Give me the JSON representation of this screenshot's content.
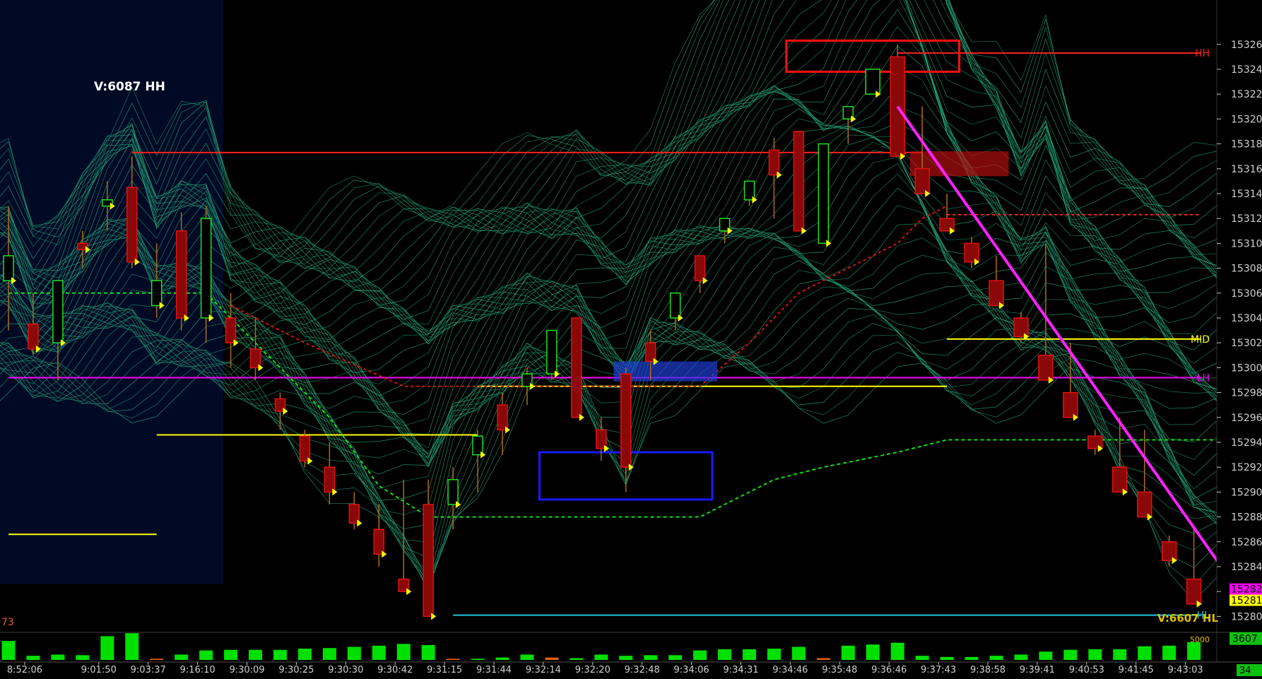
{
  "chart_data": {
    "type": "candlestick",
    "price_axis": {
      "ylim": [
        15279,
        15329
      ],
      "ticks": [
        15280,
        15282,
        15284,
        15286,
        15288,
        15290,
        15292,
        15294,
        15296,
        15298,
        15300,
        15302,
        15304,
        15306,
        15308,
        15310,
        15312,
        15314,
        15316,
        15318,
        15320,
        15322,
        15324,
        15326
      ],
      "tick_labels": [
        "15280",
        "15282",
        "15284",
        "15286",
        "15288",
        "15290",
        "15292",
        "15294",
        "15296",
        "15298",
        "15300",
        "15302",
        "15304",
        "15306",
        "15308",
        "15310",
        "15312",
        "15314",
        "15316",
        "15318",
        "15320",
        "15322",
        "15324",
        "15326"
      ],
      "markers": [
        {
          "label": "15282",
          "value": 15282.2,
          "color": "#ff00ff"
        },
        {
          "label": "15281",
          "value": 15281.3,
          "color": "#ffff00"
        }
      ]
    },
    "time_axis": {
      "labels": [
        "8:52:06",
        "9:01:50",
        "9:03:37",
        "9:16:10",
        "9:30:09",
        "9:30:25",
        "9:30:30",
        "9:30:42",
        "9:31:15",
        "9:31:44",
        "9:32:14",
        "9:32:20",
        "9:32:48",
        "9:34:06",
        "9:34:31",
        "9:34:46",
        "9:35:48",
        "9:36:46",
        "9:37:43",
        "9:38:58",
        "9:39:41",
        "9:40:53",
        "9:41:45",
        "9:43:03"
      ],
      "bar_index": [
        1,
        4,
        6,
        8,
        10,
        12,
        14,
        16,
        18,
        20,
        22,
        24,
        26,
        28,
        30,
        32,
        34,
        36,
        38,
        40,
        42,
        44,
        46,
        48
      ],
      "last_label": "34"
    },
    "annotation": "V:6087 HH",
    "bottom_text": "V:6607 HL",
    "volume_info": {
      "scale_max_label": "5000",
      "current_label": "3607",
      "current_value": 3607,
      "left_value": "73"
    },
    "level_labels": [
      {
        "label": "HH",
        "value": 15325.3,
        "color": "#ff2020"
      },
      {
        "label": "MID",
        "value": 15302.3,
        "color": "#ffff00"
      },
      {
        "label": "LH",
        "value": 15299.2,
        "color": "#ff00ff"
      },
      {
        "label": "HL",
        "value": 15280.1,
        "color": "#20c8e0"
      }
    ],
    "levels": [
      {
        "name": "HH",
        "value": 15325.3,
        "x_from": 36,
        "x_to": 50,
        "color": "#ff2020"
      },
      {
        "name": "upper-red",
        "value": 15317.3,
        "x_from": 5,
        "x_to": 37,
        "color": "#ff2020"
      },
      {
        "name": "red-dashed",
        "value": 15312.3,
        "x_from": 38,
        "x_to": 50,
        "color": "#ff2020",
        "dashed": true
      },
      {
        "name": "MID",
        "value": 15302.3,
        "x_from": 38,
        "x_to": 50,
        "color": "#ffff00"
      },
      {
        "name": "LH",
        "value": 15299.2,
        "x_from": 0,
        "x_to": 50,
        "color": "#ff00ff"
      },
      {
        "name": "yellow-mid",
        "value": 15298.5,
        "x_from": 19,
        "x_to": 38,
        "color": "#ffff00"
      },
      {
        "name": "yellow-low",
        "value": 15294.6,
        "x_from": 6,
        "x_to": 19,
        "color": "#ffff00"
      },
      {
        "name": "yellow-left",
        "value": 15286.6,
        "x_from": 0,
        "x_to": 6,
        "color": "#ffff00"
      },
      {
        "name": "HL",
        "value": 15280.1,
        "x_from": 18,
        "x_to": 50,
        "color": "#20c8e0"
      }
    ],
    "green_dashed_line": [
      [
        0,
        15306.0
      ],
      [
        8,
        15306.0
      ],
      [
        10,
        15302.0
      ],
      [
        13,
        15296.0
      ],
      [
        15,
        15290.5
      ],
      [
        17,
        15288.0
      ],
      [
        28,
        15288.0
      ],
      [
        31,
        15291.0
      ],
      [
        33,
        15292.0
      ],
      [
        36,
        15293.2
      ],
      [
        38,
        15294.2
      ],
      [
        50,
        15294.2
      ]
    ],
    "red_dashed_line": [
      [
        9,
        15305.0
      ],
      [
        12,
        15302.0
      ],
      [
        16,
        15298.5
      ],
      [
        28,
        15298.5
      ],
      [
        30,
        15302.0
      ],
      [
        32,
        15306.0
      ],
      [
        34,
        15308.0
      ],
      [
        36,
        15310.0
      ],
      [
        37,
        15312.0
      ],
      [
        38,
        15313.0
      ]
    ],
    "trend_line": [
      [
        36,
        15321.0
      ],
      [
        50,
        15281.5
      ]
    ],
    "zones": [
      {
        "name": "red-zone",
        "x_from": 36.5,
        "x_to": 40.5,
        "y_from": 15315.4,
        "y_to": 15317.4,
        "color": "#c01010",
        "style": "fill"
      },
      {
        "name": "blue-zone",
        "x_from": 24.5,
        "x_to": 28.7,
        "y_from": 15298.9,
        "y_to": 15300.5,
        "color": "#2040e0",
        "style": "fill"
      },
      {
        "name": "red-box",
        "x_from": 31.5,
        "x_to": 38.5,
        "y_from": 15323.8,
        "y_to": 15326.3,
        "color": "#ff1010",
        "style": "outline"
      },
      {
        "name": "blue-box",
        "x_from": 21.5,
        "x_to": 28.5,
        "y_from": 15289.4,
        "y_to": 15293.2,
        "color": "#1a1aff",
        "style": "outline"
      }
    ],
    "candles": [
      {
        "o": 15307,
        "h": 15313,
        "l": 15303,
        "c": 15309
      },
      {
        "o": 15303.5,
        "h": 15306,
        "l": 15301,
        "c": 15301.5
      },
      {
        "o": 15302,
        "h": 15307,
        "l": 15299,
        "c": 15307
      },
      {
        "o": 15310,
        "h": 15311,
        "l": 15308,
        "c": 15309.5
      },
      {
        "o": 15313,
        "h": 15315,
        "l": 15311,
        "c": 15313.5
      },
      {
        "o": 15314.5,
        "h": 15317,
        "l": 15308,
        "c": 15308.5
      },
      {
        "o": 15305,
        "h": 15310,
        "l": 15304,
        "c": 15307
      },
      {
        "o": 15311,
        "h": 15312.5,
        "l": 15303,
        "c": 15304
      },
      {
        "o": 15304,
        "h": 15313,
        "l": 15302,
        "c": 15312
      },
      {
        "o": 15304,
        "h": 15306,
        "l": 15300,
        "c": 15302
      },
      {
        "o": 15301.5,
        "h": 15304,
        "l": 15299,
        "c": 15300
      },
      {
        "o": 15297.5,
        "h": 15298,
        "l": 15295,
        "c": 15296.5
      },
      {
        "o": 15294.5,
        "h": 15295,
        "l": 15292,
        "c": 15292.5
      },
      {
        "o": 15292,
        "h": 15294,
        "l": 15289,
        "c": 15290
      },
      {
        "o": 15289,
        "h": 15290,
        "l": 15287,
        "c": 15287.5
      },
      {
        "o": 15287,
        "h": 15289,
        "l": 15284,
        "c": 15285
      },
      {
        "o": 15283,
        "h": 15291,
        "l": 15282,
        "c": 15282
      },
      {
        "o": 15289,
        "h": 15291,
        "l": 15280,
        "c": 15280
      },
      {
        "o": 15289,
        "h": 15292,
        "l": 15287,
        "c": 15291
      },
      {
        "o": 15293,
        "h": 15295,
        "l": 15290,
        "c": 15294.5
      },
      {
        "o": 15297,
        "h": 15298,
        "l": 15293,
        "c": 15295
      },
      {
        "o": 15298.5,
        "h": 15300,
        "l": 15297,
        "c": 15299.5
      },
      {
        "o": 15299.5,
        "h": 15303,
        "l": 15299,
        "c": 15303
      },
      {
        "o": 15304,
        "h": 15304,
        "l": 15296,
        "c": 15296
      },
      {
        "o": 15295,
        "h": 15296,
        "l": 15292.5,
        "c": 15293.5
      },
      {
        "o": 15299.5,
        "h": 15300,
        "l": 15290,
        "c": 15292
      },
      {
        "o": 15302,
        "h": 15303,
        "l": 15299,
        "c": 15300.5
      },
      {
        "o": 15304,
        "h": 15306,
        "l": 15303,
        "c": 15306
      },
      {
        "o": 15309,
        "h": 15309,
        "l": 15306,
        "c": 15307
      },
      {
        "o": 15311,
        "h": 15312,
        "l": 15310,
        "c": 15312
      },
      {
        "o": 15313.5,
        "h": 15315,
        "l": 15313,
        "c": 15315
      },
      {
        "o": 15317.5,
        "h": 15318.5,
        "l": 15312,
        "c": 15315.5
      },
      {
        "o": 15319,
        "h": 15319,
        "l": 15311,
        "c": 15311
      },
      {
        "o": 15310,
        "h": 15318,
        "l": 15310,
        "c": 15318
      },
      {
        "o": 15320,
        "h": 15321,
        "l": 15318,
        "c": 15321
      },
      {
        "o": 15322,
        "h": 15324,
        "l": 15322,
        "c": 15324
      },
      {
        "o": 15325,
        "h": 15326,
        "l": 15317,
        "c": 15317
      },
      {
        "o": 15316,
        "h": 15321,
        "l": 15314,
        "c": 15314
      },
      {
        "o": 15312,
        "h": 15314,
        "l": 15311,
        "c": 15311
      },
      {
        "o": 15310,
        "h": 15310.5,
        "l": 15308,
        "c": 15308.5
      },
      {
        "o": 15307,
        "h": 15309,
        "l": 15305,
        "c": 15305
      },
      {
        "o": 15304,
        "h": 15304.5,
        "l": 15302,
        "c": 15302.5
      },
      {
        "o": 15301,
        "h": 15310,
        "l": 15299,
        "c": 15299
      },
      {
        "o": 15298,
        "h": 15302,
        "l": 15296,
        "c": 15296
      },
      {
        "o": 15294.5,
        "h": 15295,
        "l": 15293,
        "c": 15293.5
      },
      {
        "o": 15292,
        "h": 15296,
        "l": 15290,
        "c": 15290
      },
      {
        "o": 15290,
        "h": 15295,
        "l": 15288,
        "c": 15288
      },
      {
        "o": 15286,
        "h": 15286.5,
        "l": 15284,
        "c": 15284.5
      },
      {
        "o": 15283,
        "h": 15287,
        "l": 15281,
        "c": 15281
      }
    ],
    "volume": [
      3200,
      700,
      900,
      800,
      4000,
      4500,
      200,
      900,
      1600,
      1700,
      1700,
      1700,
      1900,
      2000,
      2200,
      2400,
      2700,
      2500,
      200,
      200,
      400,
      900,
      400,
      300,
      900,
      700,
      800,
      800,
      1600,
      1800,
      1800,
      1900,
      2200,
      300,
      2400,
      2600,
      2900,
      700,
      500,
      500,
      700,
      900,
      1400,
      1700,
      1800,
      1800,
      2300,
      2400,
      3000
    ],
    "volume_colors": [
      "#00e000",
      "#00e000",
      "#00e000",
      "#00e000",
      "#00e000",
      "#00e000",
      "#e06010",
      "#00e000",
      "#00e000",
      "#00e000",
      "#00e000",
      "#00e000",
      "#00e000",
      "#00e000",
      "#00e000",
      "#00e000",
      "#00e000",
      "#00e000",
      "#e06010",
      "#00e000",
      "#00e000",
      "#00e000",
      "#e06010",
      "#00e000",
      "#00e000",
      "#00e000",
      "#00e000",
      "#00e000",
      "#00e000",
      "#00e000",
      "#00e000",
      "#00e000",
      "#00e000",
      "#e06010",
      "#00e000",
      "#00e000",
      "#00e000",
      "#00e000",
      "#00e000",
      "#00e000",
      "#00e000",
      "#00e000",
      "#00e000",
      "#00e000",
      "#00e000",
      "#00e000",
      "#00e000",
      "#00e000",
      "#00e000"
    ]
  }
}
